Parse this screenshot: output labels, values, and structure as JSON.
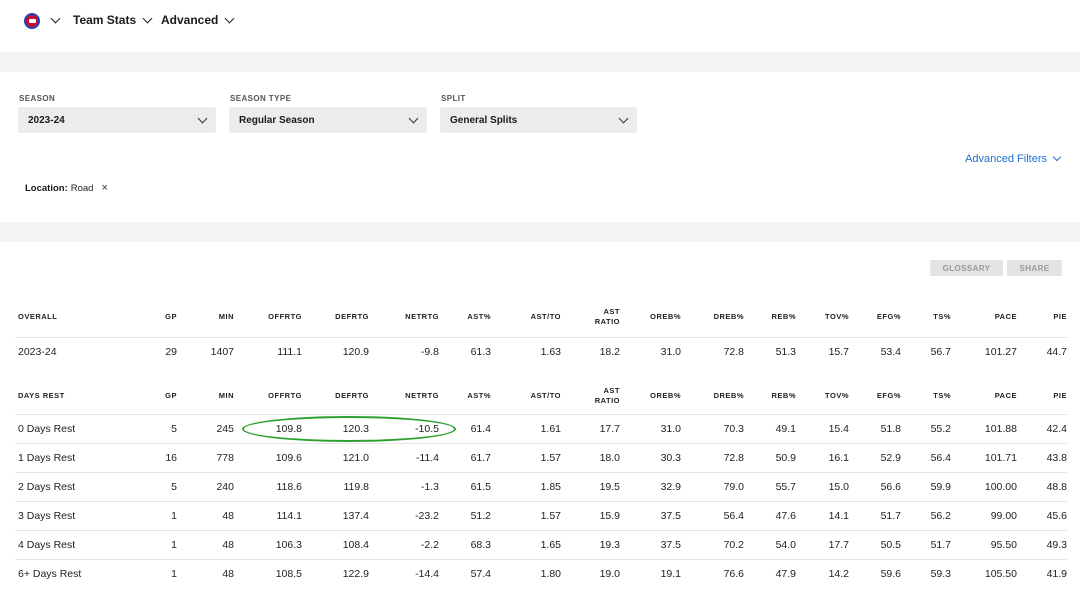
{
  "nav": {
    "team_logo": "pistons-logo-icon",
    "menu1": "Team Stats",
    "menu2": "Advanced"
  },
  "filters": {
    "season": {
      "label": "SEASON",
      "value": "2023-24"
    },
    "season_type": {
      "label": "SEASON TYPE",
      "value": "Regular Season"
    },
    "split": {
      "label": "SPLIT",
      "value": "General Splits"
    },
    "advanced_filters": "Advanced Filters",
    "chip": {
      "key": "Location:",
      "value": "Road",
      "remove": "×"
    }
  },
  "buttons": {
    "glossary": "GLOSSARY",
    "share": "SHARE"
  },
  "columns": [
    "GP",
    "MIN",
    "OFFRTG",
    "DEFRTG",
    "NETRTG",
    "AST%",
    "AST/TO",
    "AST RATIO",
    "OREB%",
    "DREB%",
    "REB%",
    "TOV%",
    "EFG%",
    "TS%",
    "PACE",
    "PIE"
  ],
  "overall": {
    "title": "OVERALL",
    "rows": [
      {
        "label": "2023-24",
        "values": [
          "29",
          "1407",
          "111.1",
          "120.9",
          "-9.8",
          "61.3",
          "1.63",
          "18.2",
          "31.0",
          "72.8",
          "51.3",
          "15.7",
          "53.4",
          "56.7",
          "101.27",
          "44.7"
        ]
      }
    ]
  },
  "days_rest": {
    "title": "DAYS REST",
    "rows": [
      {
        "label": "0 Days Rest",
        "values": [
          "5",
          "245",
          "109.8",
          "120.3",
          "-10.5",
          "61.4",
          "1.61",
          "17.7",
          "31.0",
          "70.3",
          "49.1",
          "15.4",
          "51.8",
          "55.2",
          "101.88",
          "42.4"
        ]
      },
      {
        "label": "1 Days Rest",
        "values": [
          "16",
          "778",
          "109.6",
          "121.0",
          "-11.4",
          "61.7",
          "1.57",
          "18.0",
          "30.3",
          "72.8",
          "50.9",
          "16.1",
          "52.9",
          "56.4",
          "101.71",
          "43.8"
        ]
      },
      {
        "label": "2 Days Rest",
        "values": [
          "5",
          "240",
          "118.6",
          "119.8",
          "-1.3",
          "61.5",
          "1.85",
          "19.5",
          "32.9",
          "79.0",
          "55.7",
          "15.0",
          "56.6",
          "59.9",
          "100.00",
          "48.8"
        ]
      },
      {
        "label": "3 Days Rest",
        "values": [
          "1",
          "48",
          "114.1",
          "137.4",
          "-23.2",
          "51.2",
          "1.57",
          "15.9",
          "37.5",
          "56.4",
          "47.6",
          "14.1",
          "51.7",
          "56.2",
          "99.00",
          "45.6"
        ]
      },
      {
        "label": "4 Days Rest",
        "values": [
          "1",
          "48",
          "106.3",
          "108.4",
          "-2.2",
          "68.3",
          "1.65",
          "19.3",
          "37.5",
          "70.2",
          "54.0",
          "17.7",
          "50.5",
          "51.7",
          "95.50",
          "49.3"
        ]
      },
      {
        "label": "6+ Days Rest",
        "values": [
          "1",
          "48",
          "108.5",
          "122.9",
          "-14.4",
          "57.4",
          "1.80",
          "19.0",
          "19.1",
          "76.6",
          "47.9",
          "14.2",
          "59.6",
          "59.3",
          "105.50",
          "41.9"
        ]
      }
    ]
  }
}
